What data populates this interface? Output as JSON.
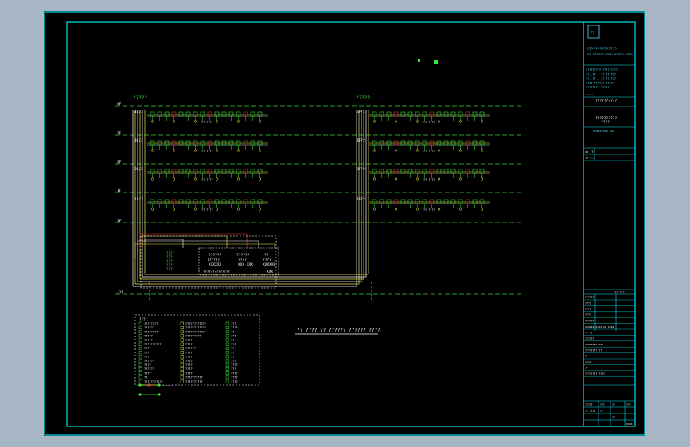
{
  "drawing": {
    "colors": {
      "background": "#000000",
      "frame": "#00e5ee",
      "grid_line": "#3bd13b",
      "wire_white": "#ffffff",
      "wire_yellow": "#f2e84b",
      "wire_red": "#e03b3b",
      "device_green": "#39e639",
      "note_text": "#ffffff"
    },
    "left_system": {
      "label": "?????",
      "floors": [
        {
          "label": "4F/2",
          "ref": "?? ????"
        },
        {
          "label": "3F/2",
          "ref": "?? ????"
        },
        {
          "label": "2F/2",
          "ref": "?? ????"
        },
        {
          "label": "1F/2",
          "ref": "?? ????"
        }
      ]
    },
    "right_system": {
      "label": "?????",
      "floors": [
        {
          "label": "4F/2",
          "ref": "?? ????"
        },
        {
          "label": "3F/2",
          "ref": "?? ????"
        },
        {
          "label": "2F/2",
          "ref": "?? ????"
        },
        {
          "label": "1F/2",
          "ref": "?? ????"
        }
      ]
    },
    "level_labels": [
      "4F",
      "3F",
      "2F",
      "1F",
      "1F",
      "-1F"
    ],
    "control_room": {
      "left_block": [
        "????",
        "????",
        "????",
        "????",
        "????"
      ],
      "panel_1": {
        "code": "??????",
        "sub": "(????)",
        "name": "XXXXXX"
      },
      "panel_2": {
        "code": "??????",
        "sub": "????",
        "name": "XXX XXX"
      },
      "panel_3": {
        "code": "??",
        "sub": "????",
        "name": "XXXXXX"
      },
      "bottom_strip": "??????????????",
      "bottom_code": "XXX"
    },
    "note": "?? ???? ?? ?????? ?????? ????",
    "legend": {
      "title": "???? ",
      "columns": [
        [
          "????????",
          "??????",
          "????????",
          "?????",
          "?????",
          "??????????",
          "????",
          "????",
          "????",
          "??????",
          "????",
          "??????",
          "????",
          "?? ",
          "???????????"
        ],
        [
          "????????????",
          "????????????",
          "???????????",
          "?????????",
          "????",
          "????",
          "??????",
          "????",
          "????",
          "????",
          "????",
          "????",
          "????",
          "??????????",
          "??????????"
        ],
        [
          "???",
          "????",
          "??",
          "???",
          "??",
          "???",
          "??",
          "??",
          "??",
          "???",
          "????",
          "???",
          "????",
          "????",
          "????"
        ]
      ],
      "footer_1": "— — —",
      "footer_2": "— — —"
    },
    "title_block": {
      "company_logo": "??",
      "company_name": "??????????????",
      "company_en": "xxxx xxxxxxxxx xxxxxx xxxxxxxx xxxxxx",
      "project_lines": [
        "????????? ?????????",
        "??, ?? — ?? ??????",
        "??, ?? — ?? ??????",
        "???? ?????? ?????",
        "???????? ?????"
      ],
      "stamp_caption": "xxxxxx",
      "drawing_name": "??????????",
      "sub_title_1": "??????????",
      "sub_title_2": "????",
      "sub_line": "xxxxxxxxx  xxx",
      "block_lines": [
        "xx  ???",
        "??  x.x"
      ],
      "revision_rows": [
        "??????",
        "????",
        "????",
        "????",
        "??????",
        "xxxxxx xxxx xx xxxx",
        "??  ??",
        "??????",
        "xxxxxxxx xxx",
        "????????   ??",
        "??",
        "xxxx",
        "??",
        "?????????????"
      ],
      "scale_label": "?? ???",
      "footer_cells": [
        "?????",
        "???",
        "??",
        "???",
        "?? ????",
        "??",
        "??",
        "xxxx"
      ]
    }
  }
}
